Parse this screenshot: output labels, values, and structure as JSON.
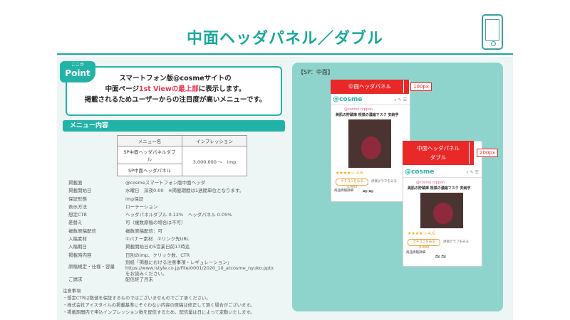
{
  "title": "中面ヘッダパネル／ダブル",
  "point": {
    "tag_small": "ここが",
    "tag_big": "Point",
    "line1": "スマートフォン版@cosmeサイトの",
    "line2_pre": "中面ページ",
    "line2_red": "1st Viewの最上部",
    "line2_post": "に表示します。",
    "line3": "掲載されるためユーザーからの注目度が高いメニューです。"
  },
  "menu": {
    "bar_label": "メニュー内容",
    "header_name": "メニュー名",
    "header_imp": "インプレッション",
    "rows": [
      "SP中面ヘッダパネルダブル",
      "SP中面ヘッダパネル"
    ],
    "imp_value": "3,000,000 ～　imp"
  },
  "specs": [
    {
      "k": "掲載面",
      "v": "@cosmeスマートフォン版中面ヘッダ"
    },
    {
      "k": "掲載開始日",
      "v": "水曜日　深夜0:00　※掲載期間は1週間単位となります。"
    },
    {
      "k": "保証形態",
      "v": "imp保証"
    },
    {
      "k": "表示方法",
      "v": "ローテーション"
    },
    {
      "k": "想定CTR",
      "v": "ヘッダパネルダブル 0.12%　ヘッダパネル 0.05%"
    },
    {
      "k": "差替え",
      "v": "可（複数原稿の場合は不可）"
    },
    {
      "k": "複数原稿配信",
      "v": "複数原稿配信：可"
    },
    {
      "k": "入稿素材",
      "v": "①バナー素材　②リンク先URL"
    },
    {
      "k": "入稿期日",
      "v": "掲載開始日の5営業日前17時迄"
    },
    {
      "k": "掲載時内容",
      "v": "日別のimp、クリック数、CTR"
    }
  ],
  "spec_tall": {
    "k": "原稿規定・仕様・容量",
    "v1": "別紙「掲載における注意事項・レギュレーション」",
    "v2": "https://www.istyle.co.jp/File/0001/2020_10_atcosme_nyuko.pptx",
    "v3": "をお読みください。"
  },
  "spec_last": {
    "k": "ご請求",
    "v": "配信終了月末"
  },
  "notes": {
    "title": "注意事項",
    "n1": "・想定CTRは数値を保証するものではございませんのでご了承ください。",
    "n2": "・株式会社アイスタイルの掲載基準にそぐわない内容の原稿は修正して頂く場合がございます。",
    "n3": "・掲載期間内で申込インプレッション数を配信するため、配信量は日によって変動いたします。"
  },
  "sp_label": "【SP：中面】",
  "mock": {
    "header1": "中面ヘッダパネル",
    "px1": "100px",
    "header2_l1": "中面ヘッダパネル",
    "header2_l2": "ダブル",
    "px2": "200px",
    "logo": "@cosme",
    "brand": "@cosme.nippon",
    "product": "美肌の貯蔵庫 根菜の濃縮マスク 安納芋",
    "rating": "★★★★☆ 4.6",
    "btn1": "クチコミをみる(1000)",
    "btn2": "評価グラフをみる",
    "info": "商品情報詳細"
  },
  "colors": {
    "accent": "#1aa89b",
    "red": "#ea2828",
    "panel": "#8ed4cc"
  }
}
